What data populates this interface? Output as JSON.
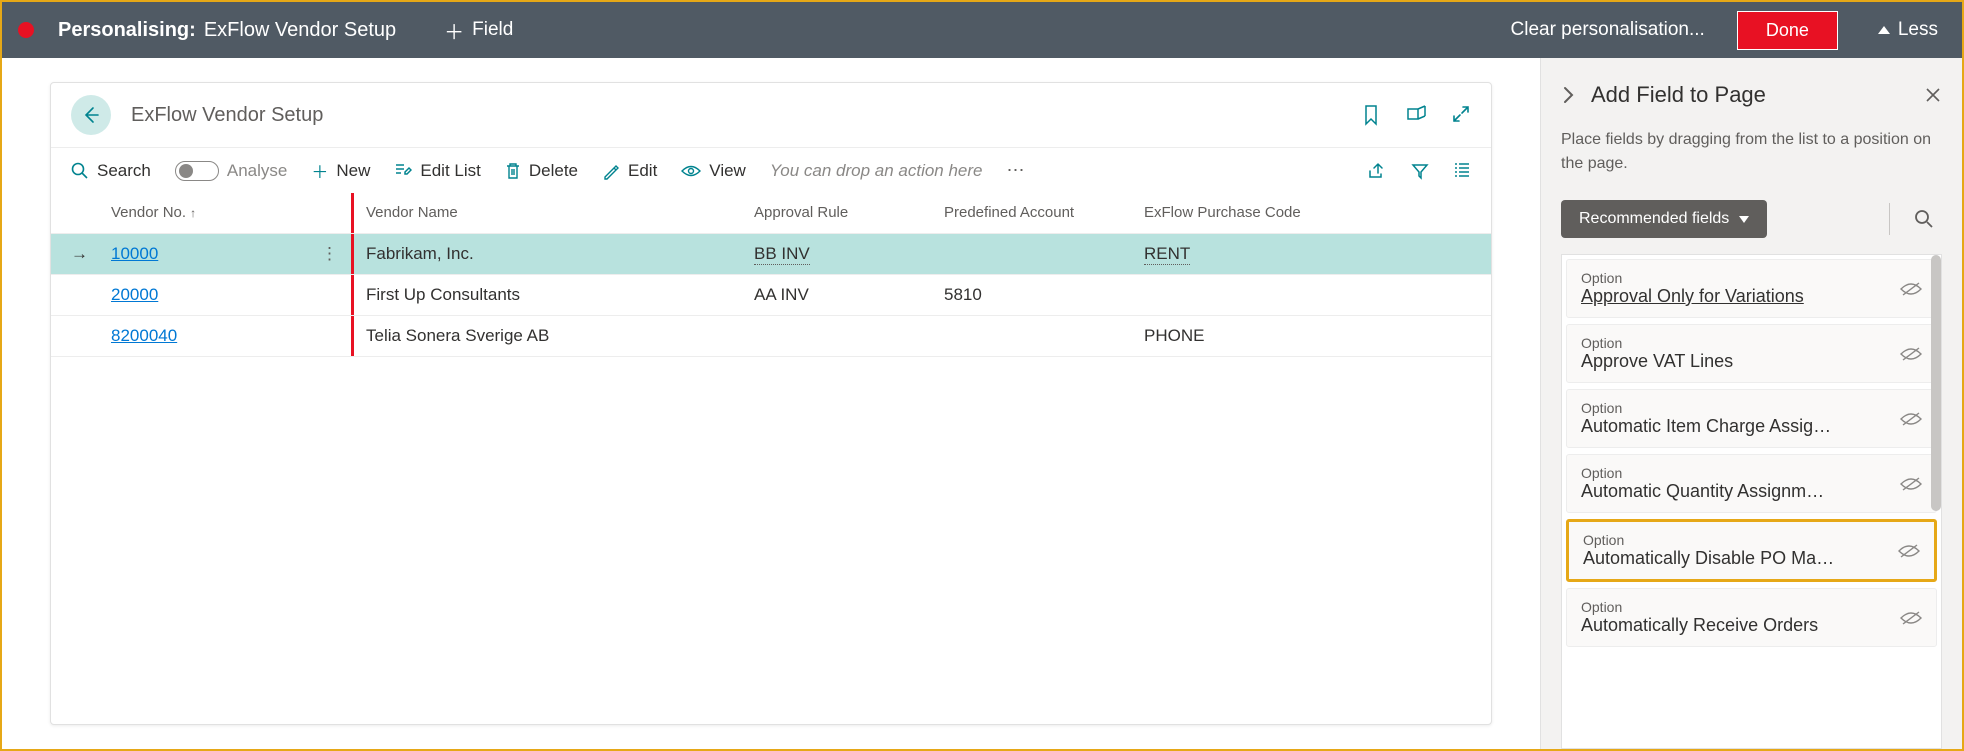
{
  "topbar": {
    "title_label": "Personalising:",
    "title_page": "ExFlow Vendor Setup",
    "field_label": "Field",
    "clear_label": "Clear personalisation...",
    "done_label": "Done",
    "less_label": "Less"
  },
  "page": {
    "title": "ExFlow Vendor Setup"
  },
  "toolbar": {
    "search": "Search",
    "analyse": "Analyse",
    "new": "New",
    "edit_list": "Edit List",
    "delete": "Delete",
    "edit": "Edit",
    "view": "View",
    "drop_hint": "You can drop an action here"
  },
  "columns": {
    "vendor_no": "Vendor No.",
    "vendor_name": "Vendor Name",
    "approval_rule": "Approval Rule",
    "predefined_account": "Predefined Account",
    "exflow_code": "ExFlow Purchase Code"
  },
  "rows": [
    {
      "vendor_no": "10000",
      "vendor_name": "Fabrikam, Inc.",
      "approval_rule": "BB INV",
      "predefined_account": "",
      "exflow_code": "RENT",
      "selected": true
    },
    {
      "vendor_no": "20000",
      "vendor_name": "First Up Consultants",
      "approval_rule": "AA INV",
      "predefined_account": "5810",
      "exflow_code": "",
      "selected": false
    },
    {
      "vendor_no": "8200040",
      "vendor_name": "Telia Sonera Sverige AB",
      "approval_rule": "",
      "predefined_account": "",
      "exflow_code": "PHONE",
      "selected": false
    }
  ],
  "panel": {
    "title": "Add Field to Page",
    "desc": "Place fields by dragging from the list to a position on the page.",
    "filter_label": "Recommended fields",
    "option_label": "Option"
  },
  "fields": [
    {
      "name": "Approval Only for Variations",
      "underline": true,
      "highlight": false
    },
    {
      "name": "Approve VAT Lines",
      "underline": false,
      "highlight": false
    },
    {
      "name": "Automatic Item Charge Assig…",
      "underline": false,
      "highlight": false
    },
    {
      "name": "Automatic Quantity Assignm…",
      "underline": false,
      "highlight": false
    },
    {
      "name": "Automatically Disable PO Ma…",
      "underline": false,
      "highlight": true
    },
    {
      "name": "Automatically Receive Orders",
      "underline": false,
      "highlight": false
    }
  ]
}
